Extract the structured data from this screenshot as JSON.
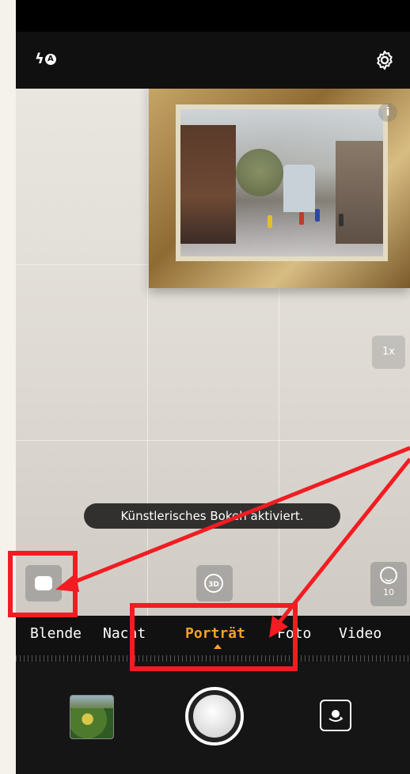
{
  "top_bar": {
    "flash_icon": "flash-auto-icon",
    "flash_badge": "A",
    "settings_icon": "gear-icon"
  },
  "viewfinder": {
    "info_label": "i",
    "zoom_label": "1x",
    "toast_message": "Künstlerisches Bokeh aktiviert.",
    "threed_label": "3D",
    "beauty_level": "10"
  },
  "modes": {
    "items": [
      "Blende",
      "Nacht",
      "Porträt",
      "Foto",
      "Video"
    ],
    "active": "Porträt",
    "active_color": "#f4a12a"
  },
  "annotation": {
    "color": "#f21c22"
  }
}
